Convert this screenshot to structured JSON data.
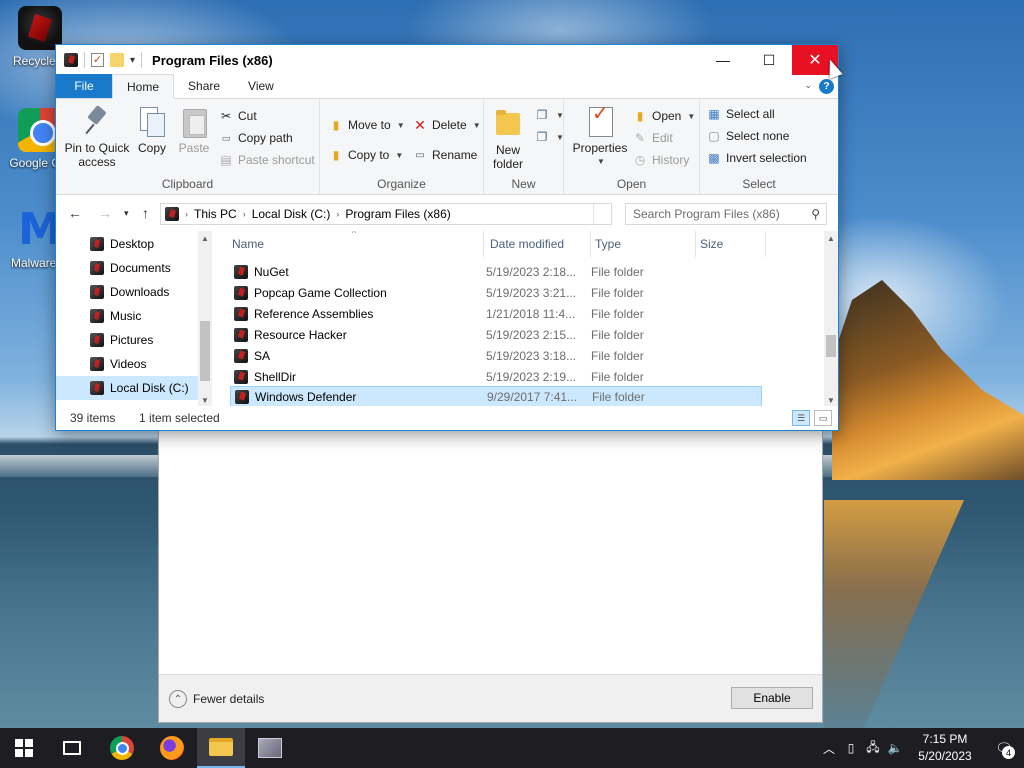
{
  "desktop": {
    "icons": [
      {
        "label": "Recycle B"
      },
      {
        "label": "Google Chr"
      },
      {
        "label": "Malwareby"
      }
    ]
  },
  "window": {
    "title": "Program Files (x86)",
    "controls": {
      "minimize": "—",
      "maximize": "☐",
      "close": "✕"
    }
  },
  "tabs": {
    "file": "File",
    "home": "Home",
    "share": "Share",
    "view": "View",
    "help": "?"
  },
  "ribbon": {
    "clipboard": {
      "label": "Clipboard",
      "pin_line1": "Pin to Quick",
      "pin_line2": "access",
      "copy": "Copy",
      "paste": "Paste",
      "cut": "Cut",
      "copy_path": "Copy path",
      "paste_shortcut": "Paste shortcut"
    },
    "organize": {
      "label": "Organize",
      "move_to": "Move to",
      "copy_to": "Copy to",
      "delete": "Delete",
      "rename": "Rename"
    },
    "new": {
      "label": "New",
      "new_line1": "New",
      "new_line2": "folder"
    },
    "open": {
      "label": "Open",
      "properties": "Properties",
      "open": "Open",
      "edit": "Edit",
      "history": "History"
    },
    "select": {
      "label": "Select",
      "select_all": "Select all",
      "select_none": "Select none",
      "invert_selection": "Invert selection"
    }
  },
  "address": {
    "crumbs": [
      "This PC",
      "Local Disk (C:)",
      "Program Files (x86)"
    ],
    "search_placeholder": "Search Program Files (x86)"
  },
  "nav_pane": [
    {
      "label": "Desktop"
    },
    {
      "label": "Documents"
    },
    {
      "label": "Downloads"
    },
    {
      "label": "Music"
    },
    {
      "label": "Pictures"
    },
    {
      "label": "Videos"
    },
    {
      "label": "Local Disk (C:)"
    }
  ],
  "columns": {
    "name": "Name",
    "date": "Date modified",
    "type": "Type",
    "size": "Size"
  },
  "files": [
    {
      "name": "NuGet",
      "date": "5/19/2023 2:18...",
      "type": "File folder"
    },
    {
      "name": "Popcap Game Collection",
      "date": "5/19/2023 3:21...",
      "type": "File folder"
    },
    {
      "name": "Reference Assemblies",
      "date": "1/21/2018 11:4...",
      "type": "File folder"
    },
    {
      "name": "Resource Hacker",
      "date": "5/19/2023 2:15...",
      "type": "File folder"
    },
    {
      "name": "SA",
      "date": "5/19/2023 3:18...",
      "type": "File folder"
    },
    {
      "name": "ShellDir",
      "date": "5/19/2023 2:19...",
      "type": "File folder"
    },
    {
      "name": "Windows Defender",
      "date": "9/29/2017 7:41...",
      "type": "File folder"
    }
  ],
  "status": {
    "count": "39 items",
    "selected": "1 item selected"
  },
  "background_dialog": {
    "fewer_details": "Fewer details",
    "enable": "Enable"
  },
  "taskbar": {
    "time": "7:15 PM",
    "date": "5/20/2023",
    "notification_count": "4"
  },
  "colors": {
    "accent": "#1979ca",
    "selection": "#cce8ff",
    "close": "#e81123"
  }
}
